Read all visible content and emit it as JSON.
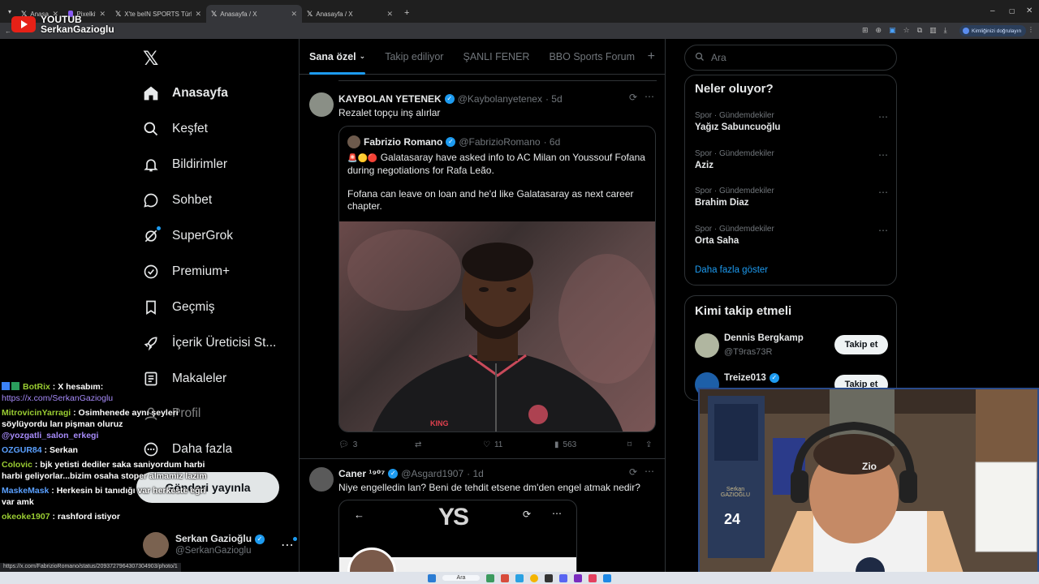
{
  "browser": {
    "tabs": [
      {
        "label": "Anasayfa / X",
        "active": false
      },
      {
        "label": "Pixelkit",
        "active": false
      },
      {
        "label": "X'te beIN SPORTS Türkiye: \"😊 !",
        "active": false
      },
      {
        "label": "Anasayfa / X",
        "active": true
      },
      {
        "label": "Anasayfa / X",
        "active": false
      }
    ],
    "new_tab": "+",
    "status_url": "https://x.com/FabrizioRomano/status/2093727964307304903/photo/1",
    "profile_chip": "Kimliğinizi doğrulayın",
    "window_controls": [
      "–",
      "▢",
      "✕"
    ]
  },
  "overlay": {
    "youtube_label": "YOUTUB",
    "channel": "SerkanGazioglu"
  },
  "nav": {
    "items": [
      {
        "label": "Anasayfa",
        "icon": "home-icon"
      },
      {
        "label": "Keşfet",
        "icon": "search-icon"
      },
      {
        "label": "Bildirimler",
        "icon": "bell-icon"
      },
      {
        "label": "Sohbet",
        "icon": "chat-icon"
      },
      {
        "label": "SuperGrok",
        "icon": "grok-icon"
      },
      {
        "label": "Premium+",
        "icon": "premium-icon"
      },
      {
        "label": "Geçmiş",
        "icon": "bookmark-icon"
      },
      {
        "label": "İçerik Üreticisi St...",
        "icon": "rocket-icon"
      },
      {
        "label": "Makaleler",
        "icon": "article-icon"
      },
      {
        "label": "Profil",
        "icon": "profile-icon"
      },
      {
        "label": "Daha fazla",
        "icon": "more-icon"
      }
    ],
    "post_button": "Gönderi yayınla",
    "profile": {
      "name": "Serkan Gazioğlu",
      "handle": "@SerkanGazioglu"
    }
  },
  "feed": {
    "tabs": [
      "Sana özel",
      "Takip ediliyor",
      "ŞANLI FENER",
      "BBO Sports Forum"
    ],
    "add_tab": "+"
  },
  "tweets": [
    {
      "name": "KAYBOLAN YETENEK",
      "handle": "@Kaybolanyetenex",
      "time": "· 5d",
      "text": "Rezalet topçu inş alırlar",
      "quote": {
        "name": "Fabrizio Romano",
        "handle": "@FabrizioRomano",
        "time": "· 6d",
        "flags": "🚨🟡🔴",
        "text1": "Galatasaray have asked info to AC Milan on Youssouf Fofana during negotiations for Rafa Leão.",
        "text2": "Fofana can leave on loan and he'd like Galatasaray as next career chapter.",
        "shirt_brand": "KING"
      },
      "stats": {
        "replies": "3",
        "reposts": "",
        "likes": "11",
        "views": "563"
      }
    },
    {
      "name": "Caner ¹⁹⁰⁷",
      "handle": "@Asgard1907",
      "time": "· 1d",
      "text": "Niye engelledin lan? Beni de tehdit etsene dm'den engel atmak nedir?",
      "screenshot_logo": "YS"
    }
  ],
  "right": {
    "search_placeholder": "Ara",
    "trends_title": "Neler oluyor?",
    "trends": [
      {
        "meta": "Spor · Gündemdekiler",
        "name": "Yağız Sabuncuoğlu"
      },
      {
        "meta": "Spor · Gündemdekiler",
        "name": "Aziz"
      },
      {
        "meta": "Spor · Gündemdekiler",
        "name": "Brahim Diaz"
      },
      {
        "meta": "Spor · Gündemdekiler",
        "name": "Orta Saha"
      }
    ],
    "show_more": "Daha fazla göster",
    "who_to_follow_title": "Kimi takip etmeli",
    "follow": [
      {
        "name": "Dennis Bergkamp",
        "handle": "@T9ras73R",
        "button": "Takip et"
      },
      {
        "name": "Treize013",
        "handle": "",
        "button": "Takip et"
      }
    ]
  },
  "chat": [
    {
      "user": "BotRix",
      "text": "X hesabım:",
      "link": "https://x.com/SerkanGazioglu",
      "color": "#9acd32"
    },
    {
      "user": "MitrovicinYarragi",
      "text": "Osimhenede aynı şeyleri söylüyordu ları pişman oluruz",
      "mention": "@yozgatli_salon_erkegi",
      "color": "#9acd32"
    },
    {
      "user": "OZGUR84",
      "text": "Serkan",
      "color": "#5aa0ff"
    },
    {
      "user": "Colovic",
      "text": "bjk yetisti dediler saka saniyordum harbi harbi geliyorlar...bizim osaha stoper almamiz lazim",
      "color": "#9acd32"
    },
    {
      "user": "MaskeMask",
      "text": "Herkesin bi tanıdığı var herkeste eğri var amk",
      "color": "#5aa0ff"
    },
    {
      "user": "okeoke1907",
      "text": "rashford istiyor",
      "color": "#9acd32"
    }
  ],
  "webcam": {
    "shelf_label": "Serkan GAZIOĞLU",
    "headset_brand": "Zio",
    "jersey_number": "24"
  },
  "colors": {
    "accent": "#1d9bf0",
    "border": "#2f3336",
    "muted": "#71767b",
    "text": "#e7e9ea"
  }
}
